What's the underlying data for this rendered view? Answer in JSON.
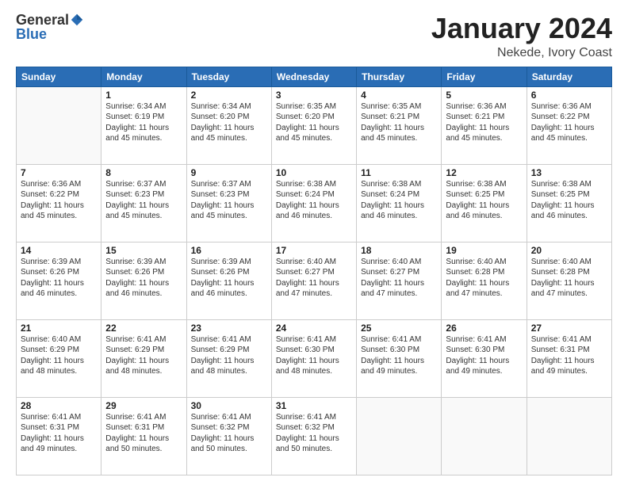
{
  "header": {
    "logo_general": "General",
    "logo_blue": "Blue",
    "title": "January 2024",
    "location": "Nekede, Ivory Coast"
  },
  "days_of_week": [
    "Sunday",
    "Monday",
    "Tuesday",
    "Wednesday",
    "Thursday",
    "Friday",
    "Saturday"
  ],
  "weeks": [
    [
      {
        "day": "",
        "sunrise": "",
        "sunset": "",
        "daylight": ""
      },
      {
        "day": "1",
        "sunrise": "Sunrise: 6:34 AM",
        "sunset": "Sunset: 6:19 PM",
        "daylight": "Daylight: 11 hours and 45 minutes."
      },
      {
        "day": "2",
        "sunrise": "Sunrise: 6:34 AM",
        "sunset": "Sunset: 6:20 PM",
        "daylight": "Daylight: 11 hours and 45 minutes."
      },
      {
        "day": "3",
        "sunrise": "Sunrise: 6:35 AM",
        "sunset": "Sunset: 6:20 PM",
        "daylight": "Daylight: 11 hours and 45 minutes."
      },
      {
        "day": "4",
        "sunrise": "Sunrise: 6:35 AM",
        "sunset": "Sunset: 6:21 PM",
        "daylight": "Daylight: 11 hours and 45 minutes."
      },
      {
        "day": "5",
        "sunrise": "Sunrise: 6:36 AM",
        "sunset": "Sunset: 6:21 PM",
        "daylight": "Daylight: 11 hours and 45 minutes."
      },
      {
        "day": "6",
        "sunrise": "Sunrise: 6:36 AM",
        "sunset": "Sunset: 6:22 PM",
        "daylight": "Daylight: 11 hours and 45 minutes."
      }
    ],
    [
      {
        "day": "7",
        "sunrise": "Sunrise: 6:36 AM",
        "sunset": "Sunset: 6:22 PM",
        "daylight": "Daylight: 11 hours and 45 minutes."
      },
      {
        "day": "8",
        "sunrise": "Sunrise: 6:37 AM",
        "sunset": "Sunset: 6:23 PM",
        "daylight": "Daylight: 11 hours and 45 minutes."
      },
      {
        "day": "9",
        "sunrise": "Sunrise: 6:37 AM",
        "sunset": "Sunset: 6:23 PM",
        "daylight": "Daylight: 11 hours and 45 minutes."
      },
      {
        "day": "10",
        "sunrise": "Sunrise: 6:38 AM",
        "sunset": "Sunset: 6:24 PM",
        "daylight": "Daylight: 11 hours and 46 minutes."
      },
      {
        "day": "11",
        "sunrise": "Sunrise: 6:38 AM",
        "sunset": "Sunset: 6:24 PM",
        "daylight": "Daylight: 11 hours and 46 minutes."
      },
      {
        "day": "12",
        "sunrise": "Sunrise: 6:38 AM",
        "sunset": "Sunset: 6:25 PM",
        "daylight": "Daylight: 11 hours and 46 minutes."
      },
      {
        "day": "13",
        "sunrise": "Sunrise: 6:38 AM",
        "sunset": "Sunset: 6:25 PM",
        "daylight": "Daylight: 11 hours and 46 minutes."
      }
    ],
    [
      {
        "day": "14",
        "sunrise": "Sunrise: 6:39 AM",
        "sunset": "Sunset: 6:26 PM",
        "daylight": "Daylight: 11 hours and 46 minutes."
      },
      {
        "day": "15",
        "sunrise": "Sunrise: 6:39 AM",
        "sunset": "Sunset: 6:26 PM",
        "daylight": "Daylight: 11 hours and 46 minutes."
      },
      {
        "day": "16",
        "sunrise": "Sunrise: 6:39 AM",
        "sunset": "Sunset: 6:26 PM",
        "daylight": "Daylight: 11 hours and 46 minutes."
      },
      {
        "day": "17",
        "sunrise": "Sunrise: 6:40 AM",
        "sunset": "Sunset: 6:27 PM",
        "daylight": "Daylight: 11 hours and 47 minutes."
      },
      {
        "day": "18",
        "sunrise": "Sunrise: 6:40 AM",
        "sunset": "Sunset: 6:27 PM",
        "daylight": "Daylight: 11 hours and 47 minutes."
      },
      {
        "day": "19",
        "sunrise": "Sunrise: 6:40 AM",
        "sunset": "Sunset: 6:28 PM",
        "daylight": "Daylight: 11 hours and 47 minutes."
      },
      {
        "day": "20",
        "sunrise": "Sunrise: 6:40 AM",
        "sunset": "Sunset: 6:28 PM",
        "daylight": "Daylight: 11 hours and 47 minutes."
      }
    ],
    [
      {
        "day": "21",
        "sunrise": "Sunrise: 6:40 AM",
        "sunset": "Sunset: 6:29 PM",
        "daylight": "Daylight: 11 hours and 48 minutes."
      },
      {
        "day": "22",
        "sunrise": "Sunrise: 6:41 AM",
        "sunset": "Sunset: 6:29 PM",
        "daylight": "Daylight: 11 hours and 48 minutes."
      },
      {
        "day": "23",
        "sunrise": "Sunrise: 6:41 AM",
        "sunset": "Sunset: 6:29 PM",
        "daylight": "Daylight: 11 hours and 48 minutes."
      },
      {
        "day": "24",
        "sunrise": "Sunrise: 6:41 AM",
        "sunset": "Sunset: 6:30 PM",
        "daylight": "Daylight: 11 hours and 48 minutes."
      },
      {
        "day": "25",
        "sunrise": "Sunrise: 6:41 AM",
        "sunset": "Sunset: 6:30 PM",
        "daylight": "Daylight: 11 hours and 49 minutes."
      },
      {
        "day": "26",
        "sunrise": "Sunrise: 6:41 AM",
        "sunset": "Sunset: 6:30 PM",
        "daylight": "Daylight: 11 hours and 49 minutes."
      },
      {
        "day": "27",
        "sunrise": "Sunrise: 6:41 AM",
        "sunset": "Sunset: 6:31 PM",
        "daylight": "Daylight: 11 hours and 49 minutes."
      }
    ],
    [
      {
        "day": "28",
        "sunrise": "Sunrise: 6:41 AM",
        "sunset": "Sunset: 6:31 PM",
        "daylight": "Daylight: 11 hours and 49 minutes."
      },
      {
        "day": "29",
        "sunrise": "Sunrise: 6:41 AM",
        "sunset": "Sunset: 6:31 PM",
        "daylight": "Daylight: 11 hours and 50 minutes."
      },
      {
        "day": "30",
        "sunrise": "Sunrise: 6:41 AM",
        "sunset": "Sunset: 6:32 PM",
        "daylight": "Daylight: 11 hours and 50 minutes."
      },
      {
        "day": "31",
        "sunrise": "Sunrise: 6:41 AM",
        "sunset": "Sunset: 6:32 PM",
        "daylight": "Daylight: 11 hours and 50 minutes."
      },
      {
        "day": "",
        "sunrise": "",
        "sunset": "",
        "daylight": ""
      },
      {
        "day": "",
        "sunrise": "",
        "sunset": "",
        "daylight": ""
      },
      {
        "day": "",
        "sunrise": "",
        "sunset": "",
        "daylight": ""
      }
    ]
  ]
}
